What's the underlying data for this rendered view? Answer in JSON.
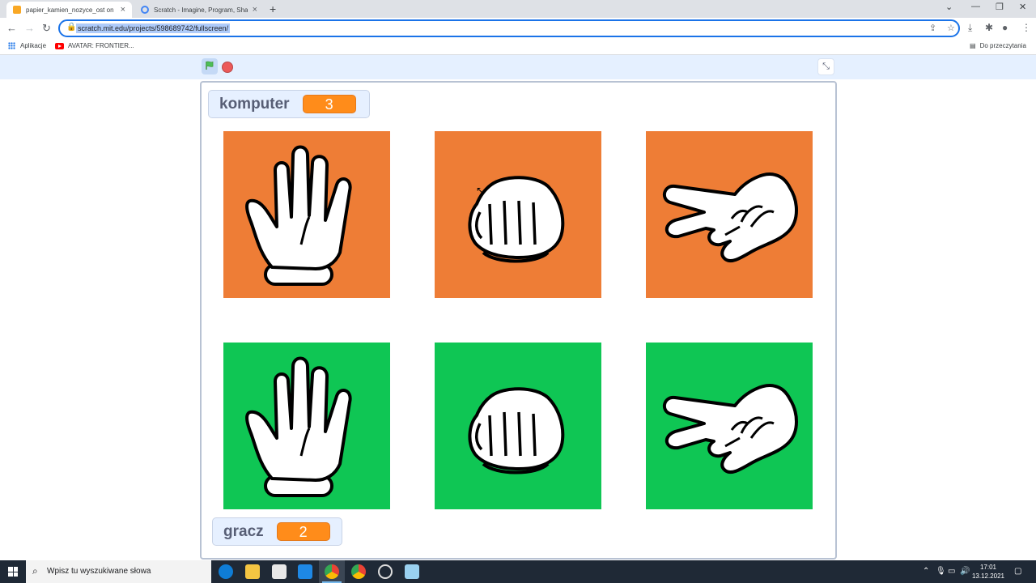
{
  "browser": {
    "tabs": [
      {
        "title": "papier_kamien_nozyce_ost on Sc",
        "active": true
      },
      {
        "title": "Scratch - Imagine, Program, Shar",
        "active": false
      }
    ],
    "url": "scratch.mit.edu/projects/598689742/fullscreen/",
    "bookmarks": [
      "Aplikacje",
      "AVATAR: FRONTIER..."
    ],
    "reading_list": "Do przeczytania"
  },
  "stage": {
    "computer_monitor": {
      "label": "komputer",
      "value": "3"
    },
    "player_monitor": {
      "label": "gracz",
      "value": "2"
    },
    "computer_cards": [
      "paper-hand-icon",
      "rock-fist-icon",
      "scissors-hand-icon"
    ],
    "player_cards": [
      "paper-hand-icon",
      "rock-fist-icon",
      "scissors-hand-icon"
    ],
    "computer_color": "#ee7d36",
    "player_color": "#0fc654"
  },
  "taskbar": {
    "search_placeholder": "Wpisz tu wyszukiwane słowa",
    "time": "17:01",
    "date": "13.12.2021"
  }
}
